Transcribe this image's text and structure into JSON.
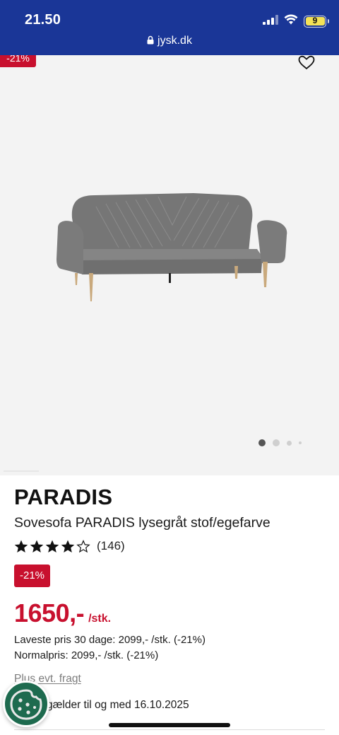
{
  "status": {
    "time": "21.50",
    "battery": "9",
    "url": "jysk.dk"
  },
  "gallery": {
    "discount_badge": "-21%",
    "favorite_icon": "heart-outline-icon",
    "image_name": "sofa-image",
    "slides": 4,
    "active_slide": 1
  },
  "product": {
    "brand": "PARADIS",
    "title": "Sovesofa PARADIS lysegråt stof/egefarve",
    "rating": 4,
    "rating_max": 5,
    "review_count": "(146)",
    "discount_badge": "-21%",
    "price": "1650,-",
    "price_unit": "/stk.",
    "lowest_price": "Laveste pris 30 dage: 2099,- /stk. (-21%)",
    "normal_price": "Normalpris: 2099,- /stk. (-21%)",
    "shipping_link": "Plus evt. fragt",
    "validity": "gælder til og med 16.10.2025"
  },
  "colors": {
    "brand_blue": "#1a3697",
    "discount_red": "#c8102e",
    "cookie_green": "#1e6b4f"
  }
}
